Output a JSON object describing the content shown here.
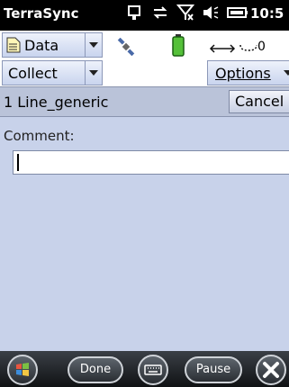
{
  "titlebar": {
    "app_title": "TerraSync",
    "clock": "10:5",
    "icons": [
      "device-sync-icon",
      "connection-icon",
      "signal-off-icon",
      "volume-icon",
      "battery-icon"
    ]
  },
  "toolbar": {
    "data_label": "Data",
    "status_icons": [
      "satellite-icon",
      "battery-green-icon",
      "bluetooth-arrow-icon"
    ],
    "range_value": "0"
  },
  "mode": {
    "collect_label": "Collect",
    "options_label": "Options"
  },
  "form": {
    "title": "1 Line_generic",
    "cancel_label": "Cancel",
    "comment_label": "Comment:",
    "comment_value": ""
  },
  "bottombar": {
    "start_icon": "windows-start-icon",
    "done_label": "Done",
    "keyboard_icon": "keyboard-icon",
    "pause_label": "Pause",
    "close_icon": "close-icon"
  }
}
